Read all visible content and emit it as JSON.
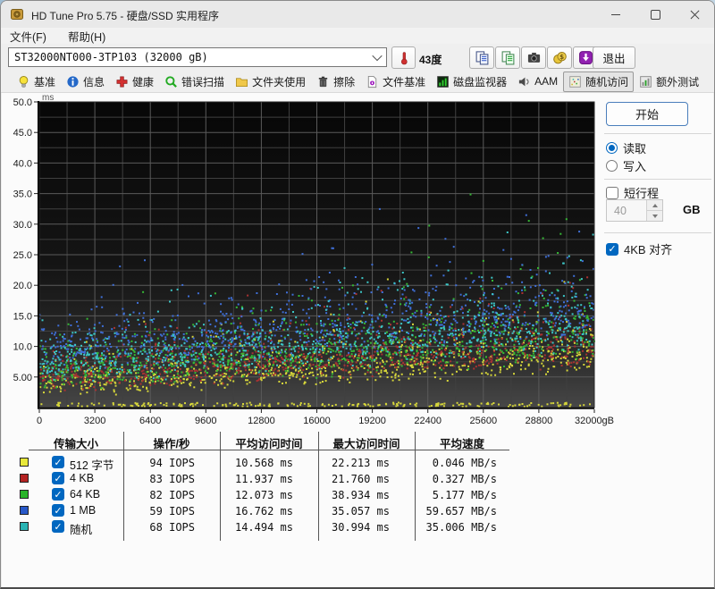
{
  "window": {
    "title": "HD Tune Pro 5.75 - 硬盘/SSD 实用程序"
  },
  "menu": {
    "items": [
      {
        "label": "文件(F)"
      },
      {
        "label": "帮助(H)"
      }
    ]
  },
  "toolbar": {
    "drive_select": {
      "value": "ST32000NT000-3TP103 (32000 gB)"
    },
    "temperature": "43度",
    "buttons": [
      {
        "key": "copy-text-button",
        "icon": "copy-pages-blue-icon"
      },
      {
        "key": "copy-image-button",
        "icon": "copy-pages-green-icon"
      },
      {
        "key": "screenshot-button",
        "icon": "camera-icon"
      },
      {
        "key": "purchase-button",
        "icon": "coins-icon"
      },
      {
        "key": "save-results-button",
        "icon": "download-arrow-icon"
      }
    ],
    "exit_label": "退出"
  },
  "tabs": [
    {
      "key": "tab-benchmark",
      "label": "基准",
      "icon": "benchmark-bulb-icon",
      "active": false
    },
    {
      "key": "tab-info",
      "label": "信息",
      "icon": "info-icon",
      "active": false
    },
    {
      "key": "tab-health",
      "label": "健康",
      "icon": "health-cross-icon",
      "active": false
    },
    {
      "key": "tab-error-scan",
      "label": "错误扫描",
      "icon": "error-scan-magnifier-icon",
      "active": false
    },
    {
      "key": "tab-folder-usage",
      "label": "文件夹使用",
      "icon": "folder-usage-icon",
      "active": false
    },
    {
      "key": "tab-erase",
      "label": "擦除",
      "icon": "erase-trash-icon",
      "active": false
    },
    {
      "key": "tab-file-benchmark",
      "label": "文件基准",
      "icon": "file-benchmark-icon",
      "active": false
    },
    {
      "key": "tab-disk-monitor",
      "label": "磁盘监视器",
      "icon": "disk-monitor-icon",
      "active": false
    },
    {
      "key": "tab-aam",
      "label": "AAM",
      "icon": "aam-speaker-icon",
      "active": false
    },
    {
      "key": "tab-random-access",
      "label": "随机访问",
      "icon": "random-access-icon",
      "active": true
    },
    {
      "key": "tab-extra-tests",
      "label": "额外测试",
      "icon": "extra-tests-icon",
      "active": false
    }
  ],
  "side_panel": {
    "start_label": "开始",
    "mode_options": [
      {
        "label": "读取",
        "selected": true
      },
      {
        "label": "写入",
        "selected": false
      }
    ],
    "short_stroke": {
      "label": "短行程",
      "checked": false
    },
    "capacity": {
      "value": "40",
      "unit": "GB"
    },
    "align_4kb": {
      "label": "4KB 对齐",
      "checked": true
    }
  },
  "chart_data": {
    "type": "scatter",
    "y_unit": "ms",
    "x_unit": "gB",
    "xlim": [
      0,
      32000
    ],
    "ylim": [
      0,
      50
    ],
    "x_major_ticks": [
      0,
      3200,
      6400,
      9600,
      12800,
      16000,
      19200,
      22400,
      25600,
      28800,
      32000
    ],
    "x_last_tick_label": "32000gB",
    "y_major_ticks": [
      5,
      10,
      15,
      20,
      25,
      30,
      35,
      40,
      45,
      50
    ],
    "x_minor_step": 1600,
    "y_minor_step": 2.5,
    "grid": true,
    "legend_position": "bottom-table",
    "series": [
      {
        "name": "512 字节",
        "color": "#d6d63a",
        "points": 850,
        "band_y_start": 3.2,
        "band_y_end": 7.0,
        "jitter": 2.2,
        "tail": 2.6,
        "avg_ms": 10.568,
        "max_ms": 22.213,
        "cache_band": {
          "points": 200,
          "y_min": 0.15,
          "y_max": 0.8
        }
      },
      {
        "name": "4 KB",
        "color": "#aa3232",
        "points": 850,
        "band_y_start": 4.2,
        "band_y_end": 8.2,
        "jitter": 2.4,
        "tail": 2.8,
        "avg_ms": 11.937,
        "max_ms": 21.76
      },
      {
        "name": "64 KB",
        "color": "#35b835",
        "points": 850,
        "band_y_start": 4.8,
        "band_y_end": 9.2,
        "jitter": 2.6,
        "tail": 4.0,
        "avg_ms": 12.073,
        "max_ms": 38.934
      },
      {
        "name": "1 MB",
        "color": "#3f6fd8",
        "points": 850,
        "band_y_start": 8.0,
        "band_y_end": 13.5,
        "jitter": 3.0,
        "tail": 4.2,
        "avg_ms": 16.762,
        "max_ms": 35.057
      },
      {
        "name": "随机",
        "color": "#3cc6c6",
        "points": 850,
        "band_y_start": 6.0,
        "band_y_end": 10.8,
        "jitter": 2.8,
        "tail": 3.6,
        "avg_ms": 14.494,
        "max_ms": 30.994
      }
    ]
  },
  "table": {
    "headers": [
      "传输大小",
      "操作/秒",
      "平均访问时间",
      "最大访问时间",
      "平均速度"
    ],
    "rows": [
      {
        "swatch": "#e8e83a",
        "label": "512 字节",
        "checked": true,
        "ops": "94 IOPS",
        "avg": "10.568 ms",
        "max": "22.213 ms",
        "speed": "0.046 MB/s"
      },
      {
        "swatch": "#b42222",
        "label": "4 KB",
        "checked": true,
        "ops": "83 IOPS",
        "avg": "11.937 ms",
        "max": "21.760 ms",
        "speed": "0.327 MB/s"
      },
      {
        "swatch": "#28b428",
        "label": "64 KB",
        "checked": true,
        "ops": "82 IOPS",
        "avg": "12.073 ms",
        "max": "38.934 ms",
        "speed": "5.177 MB/s"
      },
      {
        "swatch": "#2858c8",
        "label": "1 MB",
        "checked": true,
        "ops": "59 IOPS",
        "avg": "16.762 ms",
        "max": "35.057 ms",
        "speed": "59.657 MB/s"
      },
      {
        "swatch": "#28b4b4",
        "label": "随机",
        "checked": true,
        "ops": "68 IOPS",
        "avg": "14.494 ms",
        "max": "30.994 ms",
        "speed": "35.006 MB/s"
      }
    ]
  }
}
